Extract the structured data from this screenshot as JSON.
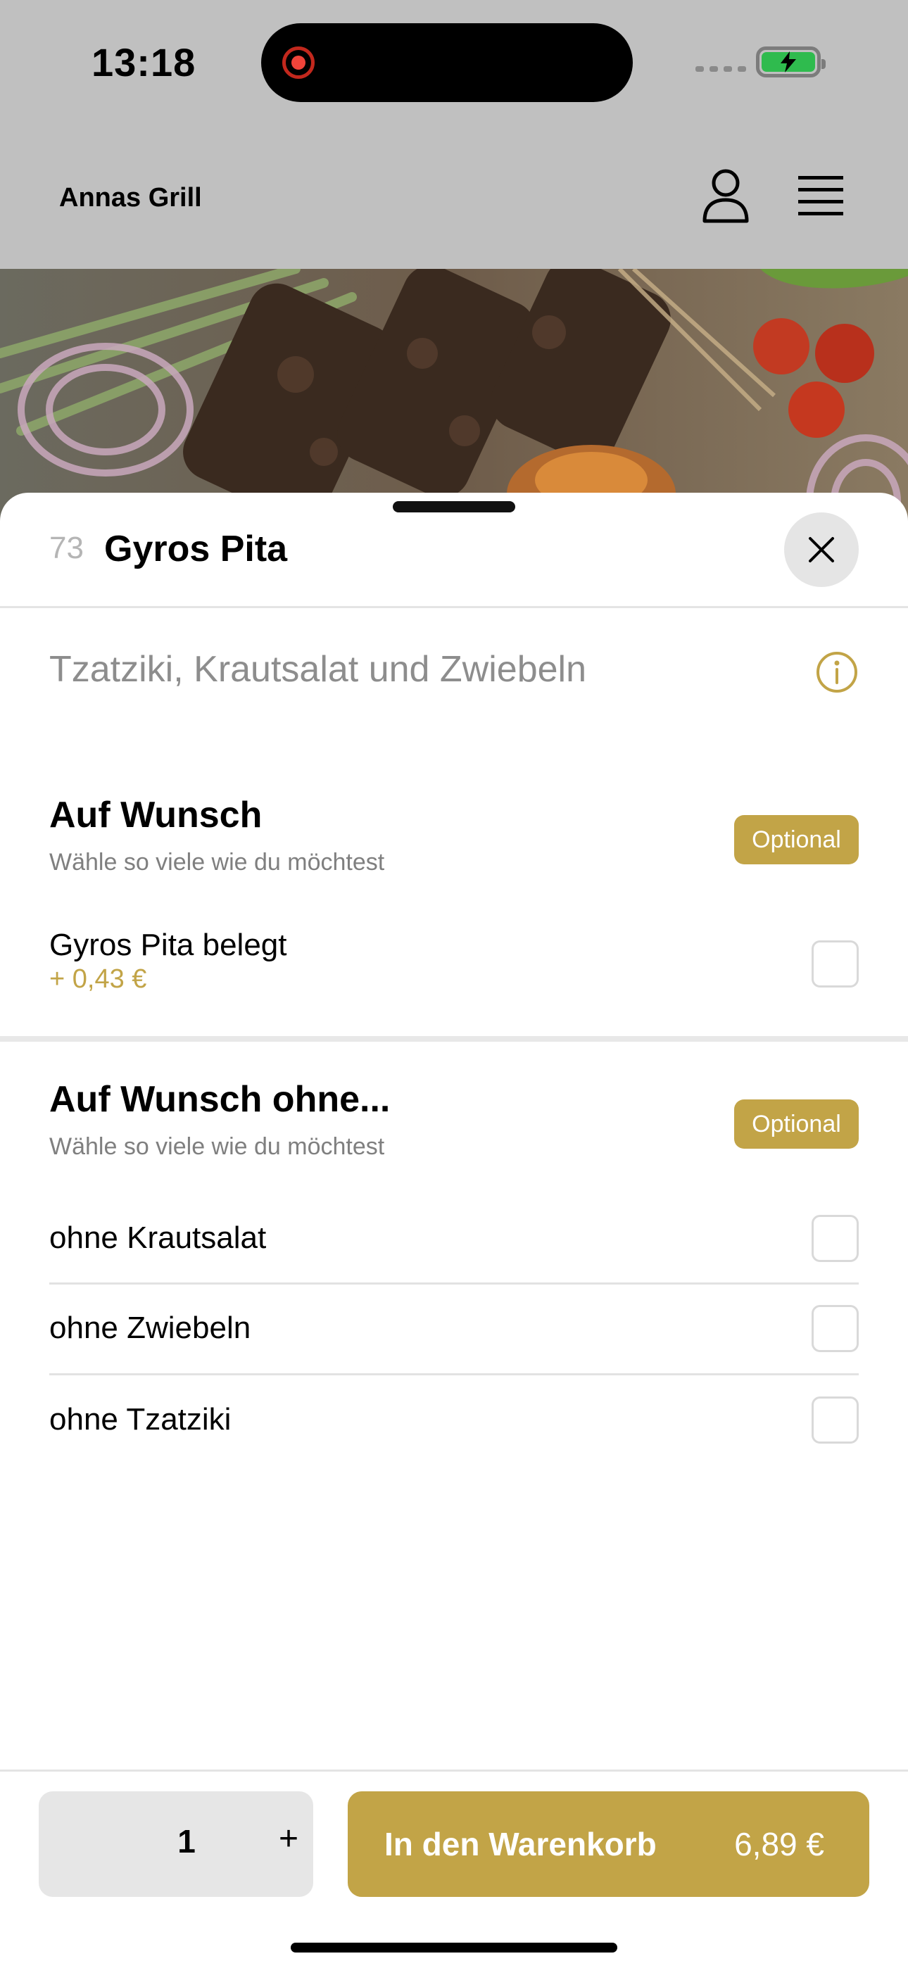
{
  "status_bar": {
    "time": "13:18"
  },
  "header": {
    "brand": "Annas Grill"
  },
  "item": {
    "number": "73",
    "title": "Gyros Pita",
    "description": "Tzatziki, Krautsalat und Zwiebeln"
  },
  "groups": [
    {
      "title": "Auf Wunsch",
      "subtitle": "Wähle so viele wie du möchtest",
      "badge": "Optional",
      "options": [
        {
          "label": "Gyros Pita belegt",
          "price": "+ 0,43 €",
          "checked": false
        }
      ]
    },
    {
      "title": "Auf Wunsch ohne...",
      "subtitle": "Wähle so viele wie du möchtest",
      "badge": "Optional",
      "options": [
        {
          "label": "ohne Krautsalat",
          "checked": false
        },
        {
          "label": "ohne Zwiebeln",
          "checked": false
        },
        {
          "label": "ohne Tzatziki",
          "checked": false
        }
      ]
    }
  ],
  "footer": {
    "quantity": "1",
    "plus": "+",
    "cart_label": "In den Warenkorb",
    "cart_price": "6,89 €"
  },
  "colors": {
    "accent": "#c2a447",
    "backdrop": "#c0c0c0"
  },
  "icons": [
    "record-icon",
    "battery-charging-icon",
    "user-icon",
    "menu-icon",
    "close-icon",
    "info-icon"
  ]
}
